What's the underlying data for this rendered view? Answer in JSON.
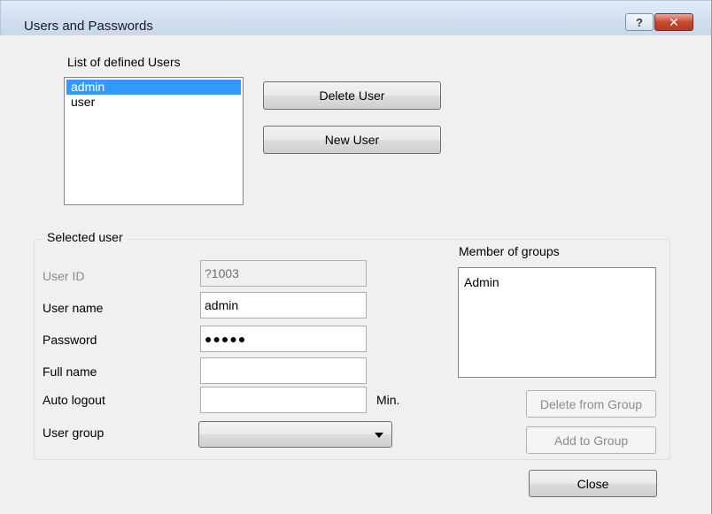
{
  "window": {
    "title": "Users and Passwords",
    "help_label": "?",
    "close_label": "✕"
  },
  "users_section": {
    "label": "List of defined Users",
    "users": [
      "admin",
      "user"
    ],
    "selected_user": "admin",
    "delete_user_label": "Delete User",
    "new_user_label": "New User"
  },
  "selected_user": {
    "legend": "Selected user",
    "user_id_label": "User ID",
    "user_id_value": "?1003",
    "user_name_label": "User name",
    "user_name_value": "admin",
    "password_label": "Password",
    "password_value": "●●●●●",
    "full_name_label": "Full name",
    "full_name_value": "",
    "auto_logout_label": "Auto logout",
    "auto_logout_value": "",
    "auto_logout_unit": "Min.",
    "user_group_label": "User group",
    "user_group_value": ""
  },
  "groups": {
    "label": "Member of groups",
    "items": [
      "Admin"
    ],
    "delete_from_group_label": "Delete from Group",
    "add_to_group_label": "Add to Group"
  },
  "footer": {
    "close_label": "Close"
  },
  "colors": {
    "selection": "#3399ff",
    "close_button": "#c8472f",
    "dialog_bg": "#f0f0f0"
  }
}
